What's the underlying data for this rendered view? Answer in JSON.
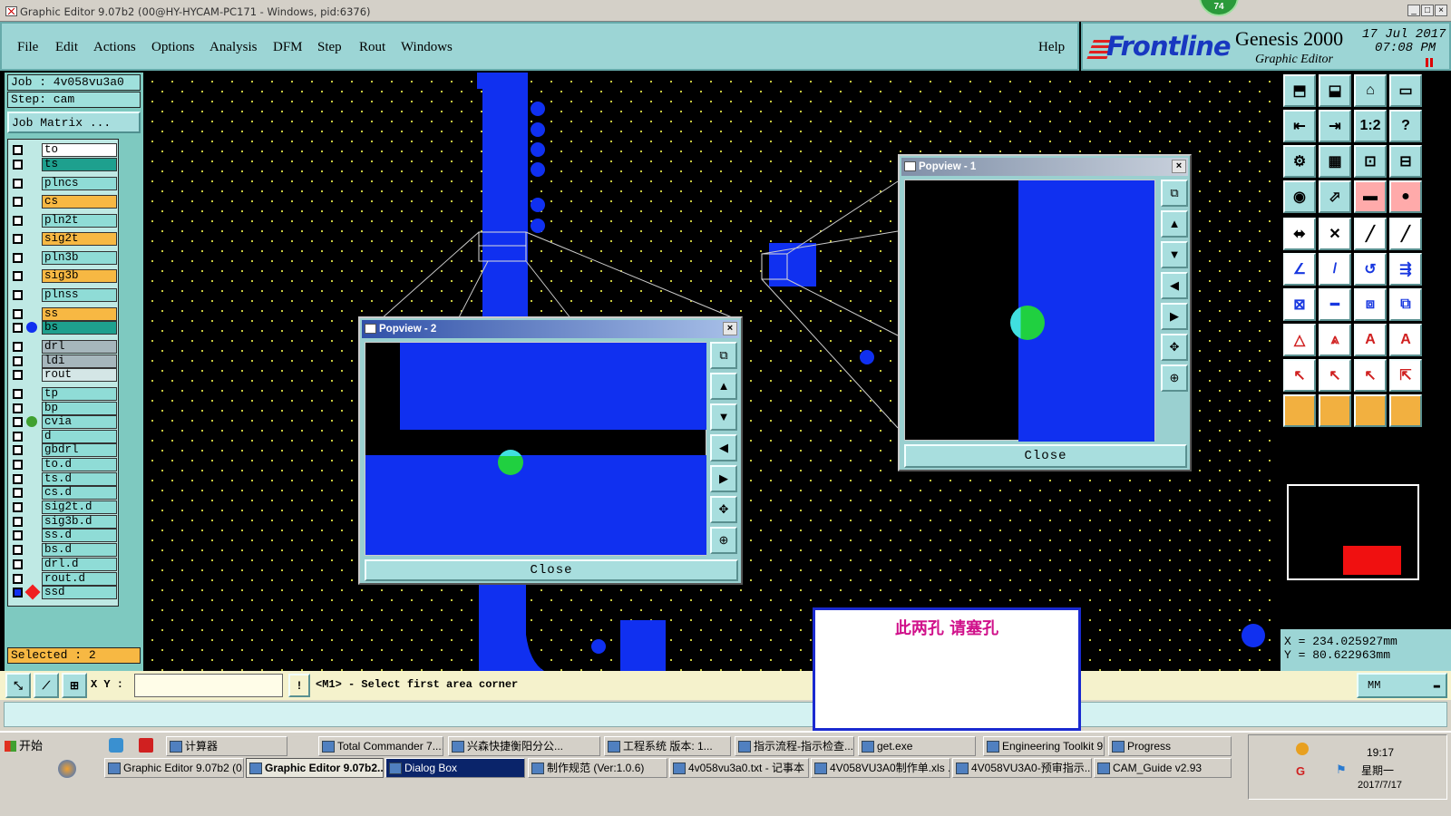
{
  "window": {
    "title": "Graphic Editor 9.07b2 (00@HY-HYCAM-PC171 - Windows, pid:6376)",
    "badge": "74",
    "controls": [
      "_",
      "□",
      "×"
    ]
  },
  "menubar": {
    "items": [
      "File",
      "Edit",
      "Actions",
      "Options",
      "Analysis",
      "DFM",
      "Step",
      "Rout",
      "Windows"
    ],
    "help": "Help"
  },
  "brand": {
    "logo": "Frontline",
    "product": "Genesis 2000",
    "subtitle": "Graphic Editor",
    "date": "17 Jul 2017",
    "time": "07:08 PM"
  },
  "left_panel": {
    "job": "Job : 4v058vu3a0",
    "step": "Step: cam",
    "job_matrix": "Job Matrix ...",
    "selected": "Selected : 2",
    "layers": [
      {
        "name": "to",
        "color": "#ffffff"
      },
      {
        "name": "ts",
        "color": "#1ea08e"
      },
      {
        "name": "plncs",
        "color": "#8fdcd6"
      },
      {
        "name": "cs",
        "color": "#f7b843"
      },
      {
        "name": "pln2t",
        "color": "#8fdcd6"
      },
      {
        "name": "sig2t",
        "color": "#f7b843"
      },
      {
        "name": "pln3b",
        "color": "#8fdcd6"
      },
      {
        "name": "sig3b",
        "color": "#f7b843"
      },
      {
        "name": "plnss",
        "color": "#8fdcd6"
      },
      {
        "name": "ss",
        "color": "#f7b843"
      },
      {
        "name": "bs",
        "color": "#1ea08e"
      },
      {
        "name": "drl",
        "color": "#a6b6bc"
      },
      {
        "name": "ldi",
        "color": "#a6b6bc"
      },
      {
        "name": "rout",
        "color": "#d4e6e6"
      },
      {
        "name": "tp",
        "color": "#8fdcd6"
      },
      {
        "name": "bp",
        "color": "#8fdcd6"
      },
      {
        "name": "cvia",
        "color": "#8fdcd6"
      },
      {
        "name": "d",
        "color": "#8fdcd6"
      },
      {
        "name": "gbdrl",
        "color": "#8fdcd6"
      },
      {
        "name": "to.d",
        "color": "#8fdcd6"
      },
      {
        "name": "ts.d",
        "color": "#8fdcd6"
      },
      {
        "name": "cs.d",
        "color": "#8fdcd6"
      },
      {
        "name": "sig2t.d",
        "color": "#8fdcd6"
      },
      {
        "name": "sig3b.d",
        "color": "#8fdcd6"
      },
      {
        "name": "ss.d",
        "color": "#8fdcd6"
      },
      {
        "name": "bs.d",
        "color": "#8fdcd6"
      },
      {
        "name": "drl.d",
        "color": "#8fdcd6"
      },
      {
        "name": "rout.d",
        "color": "#8fdcd6"
      },
      {
        "name": "ssd",
        "color": "#8fdcd6"
      }
    ]
  },
  "popview1": {
    "title": "Popview - 1",
    "close": "Close"
  },
  "popview2": {
    "title": "Popview - 2",
    "close": "Close"
  },
  "note": {
    "text": "此两孔 请塞孔"
  },
  "coords": {
    "x": "X = 234.025927mm",
    "y": "Y = 80.622963mm"
  },
  "toolbar_icons": [
    "zoom-home",
    "zoom-out",
    "home",
    "page",
    "pan-left",
    "pan-right",
    "ratio",
    "help-q",
    "measure",
    "grid",
    "snap",
    "snap2",
    "hole",
    "arrow-diag",
    "ruler",
    "circle",
    "nodes",
    "cross",
    "line",
    "line2",
    "angle",
    "slash",
    "arc",
    "route",
    "split",
    "minus",
    "box",
    "copy",
    "triangle",
    "triangle2",
    "text-a",
    "text-a2",
    "select",
    "select2",
    "select3",
    "select4"
  ],
  "toolbar_labels": {
    "ratio": "1:2",
    "help": "?"
  },
  "status": {
    "xy_label": "X Y :",
    "xy_value": "",
    "message": "<M1> - Select first area corner",
    "units": "MM"
  },
  "taskbar": {
    "start": "开始",
    "row1": [
      "计算器",
      "Total Commander 7....",
      "兴森快捷衡阳分公...",
      "工程系统  版本: 1...",
      "指示流程-指示检查...",
      "get.exe",
      "Engineering Toolkit 9....",
      "Progress"
    ],
    "row2": [
      "Graphic Editor 9.07b2 (0...",
      "Graphic Editor 9.07b2...",
      "Dialog Box",
      "制作规范 (Ver:1.0.6)",
      "4v058vu3a0.txt - 记事本",
      "4V058VU3A0制作单.xls ...",
      "4V058VU3A0-预审指示...",
      "CAM_Guide v2.93"
    ],
    "clock": "19:17",
    "weekday": "星期一",
    "date": "2017/7/17"
  },
  "colors": {
    "copper": "#1030f0",
    "hole": "#20d040",
    "panel": "#9cd5d5",
    "dots": "#c8c840"
  }
}
